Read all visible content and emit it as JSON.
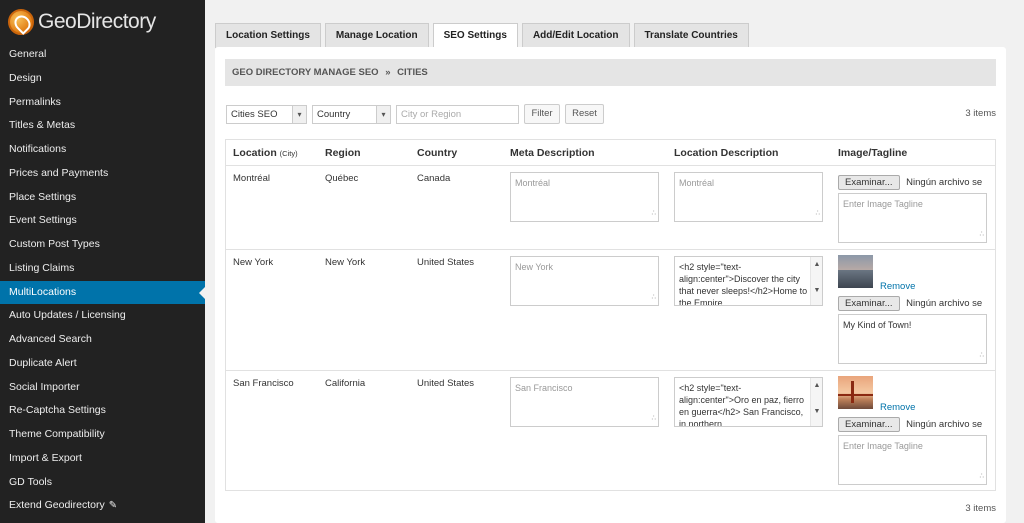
{
  "app": {
    "logo_text": "GeoDirectory",
    "accent": "#0073aa"
  },
  "sidebar": {
    "items": [
      "General",
      "Design",
      "Permalinks",
      "Titles & Metas",
      "Notifications",
      "Prices and Payments",
      "Place Settings",
      "Event Settings",
      "Custom Post Types",
      "Listing Claims",
      "MultiLocations",
      "Auto Updates / Licensing",
      "Advanced Search",
      "Duplicate Alert",
      "Social Importer",
      "Re-Captcha Settings",
      "Theme Compatibility",
      "Import & Export",
      "GD Tools",
      "Extend Geodirectory"
    ],
    "active_index": 10
  },
  "tabs": [
    "Location Settings",
    "Manage Location",
    "SEO Settings",
    "Add/Edit Location",
    "Translate Countries"
  ],
  "active_tab": 2,
  "breadcrumb": {
    "section": "GEO DIRECTORY MANAGE SEO",
    "separator": "»",
    "page": "CITIES"
  },
  "filters": {
    "type_select": "Cities SEO",
    "country_select": "Country",
    "search_placeholder": "City or Region",
    "filter_button": "Filter",
    "reset_button": "Reset"
  },
  "items_count": "3 items",
  "table": {
    "headers": {
      "location": "Location",
      "location_sub": "(City)",
      "region": "Region",
      "country": "Country",
      "meta_description": "Meta Description",
      "location_description": "Location Description",
      "image_tagline": "Image/Tagline"
    },
    "rows": [
      {
        "location": "Montréal",
        "region": "Québec",
        "country": "Canada",
        "meta_placeholder": "Montréal",
        "desc_placeholder": "Montréal",
        "file_button": "Examinar...",
        "file_status": "Ningún archivo se",
        "tagline_placeholder": "Enter Image Tagline"
      },
      {
        "location": "New York",
        "region": "New York",
        "country": "United States",
        "meta_placeholder": "New York",
        "desc_text": "<h2 style=\"text-align:center\">Discover the city that never sleeps!</h2>Home to the Empire",
        "remove": "Remove",
        "file_button": "Examinar...",
        "file_status": "Ningún archivo se",
        "tagline_value": "My Kind of Town!"
      },
      {
        "location": "San Francisco",
        "region": "California",
        "country": "United States",
        "meta_placeholder": "San Francisco",
        "desc_text": "<h2 style=\"text-align:center\">Oro en paz, fierro en guerra</h2> San Francisco, in northern",
        "remove": "Remove",
        "file_button": "Examinar...",
        "file_status": "Ningún archivo se",
        "tagline_placeholder": "Enter Image Tagline"
      }
    ]
  }
}
